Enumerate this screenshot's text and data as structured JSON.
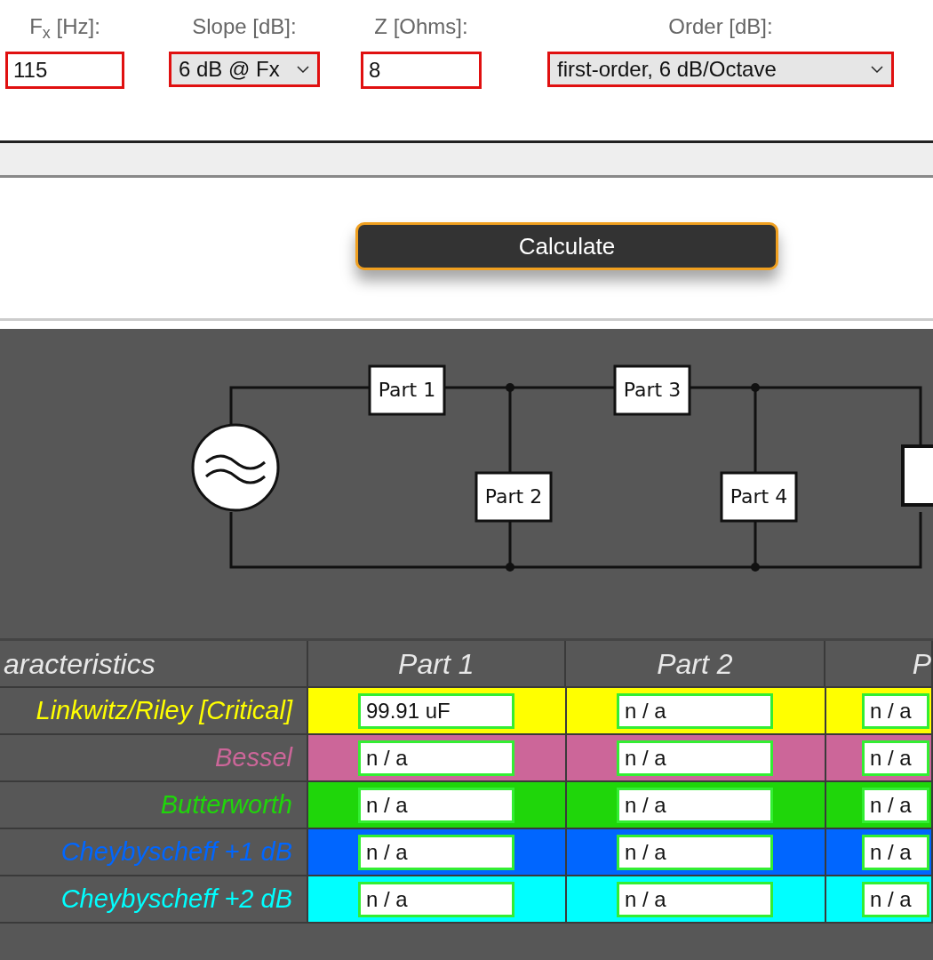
{
  "inputs": [
    {
      "kind": "text",
      "label": "F$_{x}$ [Hz]:",
      "value": "115"
    },
    {
      "kind": "select",
      "label": "Slope [dB]:",
      "value": "6 dB @ Fx"
    },
    {
      "kind": "text",
      "label": "Z [Ohms]:",
      "value": "8"
    },
    {
      "kind": "select",
      "label": "Order [dB]:",
      "value": "first-order, 6 dB/Octave"
    }
  ],
  "calculate_button": "Calculate",
  "circuit": {
    "parts": [
      "Part 1",
      "Part 2",
      "Part 3",
      "Part 4"
    ]
  },
  "table": {
    "columns": [
      "aracteristics",
      "Part 1",
      "Part 2",
      "P"
    ],
    "rows": [
      {
        "name": "Linkwitz/Riley [Critical]",
        "color": "#ffff00",
        "values": [
          "99.91 uF",
          "n / a",
          "n / a"
        ]
      },
      {
        "name": "Bessel",
        "color": "#cc6699",
        "values": [
          "n / a",
          "n / a",
          "n / a"
        ]
      },
      {
        "name": "Butterworth",
        "color": "#1fd60a",
        "values": [
          "n / a",
          "n / a",
          "n / a"
        ]
      },
      {
        "name": "Cheybyscheff +1 dB",
        "color": "#0066ff",
        "values": [
          "n / a",
          "n / a",
          "n / a"
        ]
      },
      {
        "name": "Cheybyscheff +2 dB",
        "color": "#00ffff",
        "values": [
          "n / a",
          "n / a",
          "n / a"
        ]
      }
    ]
  }
}
